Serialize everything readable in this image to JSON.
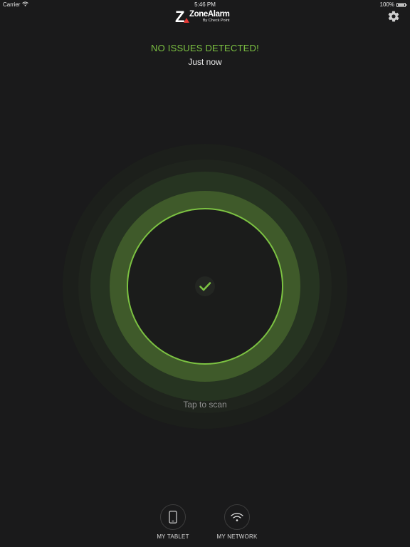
{
  "status_bar": {
    "carrier": "Carrier",
    "time": "5:46 PM",
    "battery": "100%",
    "battery_level": 1.0
  },
  "header": {
    "logo_name": "ZoneAlarm",
    "logo_sub": "By Check Point",
    "settings_icon": "gear-icon"
  },
  "scan_status": {
    "headline": "NO ISSUES DETECTED!",
    "last_scan": "Just now",
    "tap_label": "Tap to scan"
  },
  "nav": {
    "tablet_label": "MY TABLET",
    "network_label": "MY NETWORK"
  },
  "colors": {
    "accent": "#7cc242",
    "background": "#1a1a1b",
    "logo_red": "#e53935"
  }
}
